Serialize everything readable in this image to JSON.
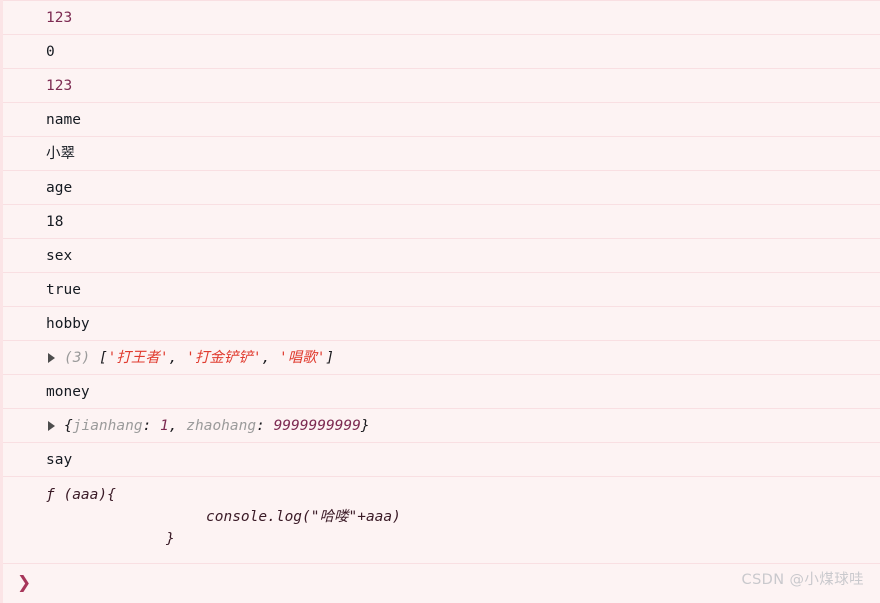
{
  "panel": {
    "name": "devtools-console",
    "background_color": "#fdf3f3",
    "separator_color": "#f9dfe2"
  },
  "rows": [
    {
      "kind": "value",
      "text": "123",
      "token": "num"
    },
    {
      "kind": "value",
      "text": "0",
      "token": "plain"
    },
    {
      "kind": "value",
      "text": "123",
      "token": "num"
    },
    {
      "kind": "value",
      "text": "name",
      "token": "plain"
    },
    {
      "kind": "value",
      "text": "小翠",
      "token": "plain"
    },
    {
      "kind": "value",
      "text": "age",
      "token": "plain"
    },
    {
      "kind": "value",
      "text": "18",
      "token": "plain"
    },
    {
      "kind": "value",
      "text": "sex",
      "token": "plain"
    },
    {
      "kind": "value",
      "text": "true",
      "token": "plain"
    },
    {
      "kind": "value",
      "text": "hobby",
      "token": "plain"
    },
    {
      "kind": "array",
      "count_label": "(3)",
      "open_bracket": "[",
      "close_bracket": "]",
      "items": [
        "'打王者'",
        "'打金铲铲'",
        "'唱歌'"
      ],
      "separator": ", "
    },
    {
      "kind": "value",
      "text": "money",
      "token": "plain"
    },
    {
      "kind": "object",
      "open_brace": "{",
      "close_brace": "}",
      "entries": [
        {
          "key": "jianhang",
          "colon": ": ",
          "value": "1"
        },
        {
          "key": "zhaohang",
          "colon": ": ",
          "value": "9999999999"
        }
      ],
      "separator": ", "
    },
    {
      "kind": "value",
      "text": "say",
      "token": "plain"
    },
    {
      "kind": "function",
      "line1": "ƒ (aaa){",
      "line2": "console.log(\"哈喽\"+aaa)",
      "line3": "}"
    }
  ],
  "prompt": {
    "chevron": "❯",
    "value": "",
    "placeholder": ""
  },
  "watermark": {
    "text": "CSDN @小煤球哇"
  }
}
